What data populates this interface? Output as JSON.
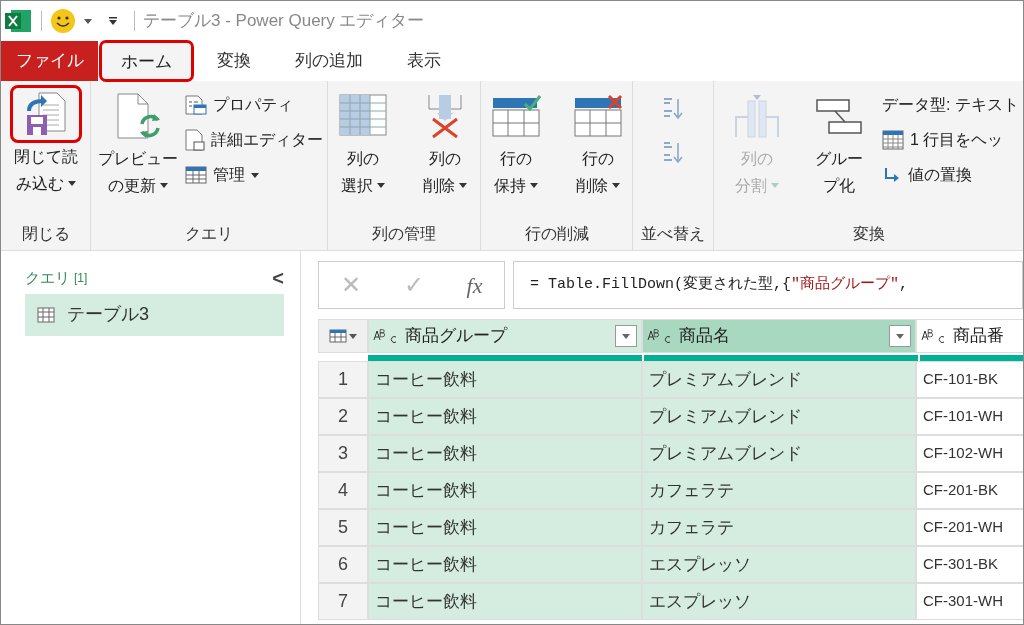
{
  "title_bar": {
    "title": "テーブル3 - Power Query エディター"
  },
  "tabs": [
    {
      "label": "ファイル",
      "kind": "file",
      "selected": false,
      "highlighted": false
    },
    {
      "label": "ホーム",
      "kind": "tab",
      "selected": true,
      "highlighted": true
    },
    {
      "label": "変換",
      "kind": "tab",
      "selected": false,
      "highlighted": false
    },
    {
      "label": "列の追加",
      "kind": "tab",
      "selected": false,
      "highlighted": false
    },
    {
      "label": "表示",
      "kind": "tab",
      "selected": false,
      "highlighted": false
    }
  ],
  "ribbon": {
    "groups": [
      {
        "label": "閉じる",
        "items": [
          {
            "kind": "large",
            "lines": [
              "閉じて読",
              "み込む"
            ],
            "dropdown": true,
            "disabled": false,
            "highlighted": true
          }
        ]
      },
      {
        "label": "クエリ",
        "items": [
          {
            "kind": "large",
            "lines": [
              "プレビュー",
              "の更新"
            ],
            "dropdown": true,
            "disabled": false,
            "highlighted": false
          },
          {
            "kind": "stack",
            "items": [
              {
                "label": "プロパティ",
                "dropdown": false
              },
              {
                "label": "詳細エディター",
                "dropdown": false
              },
              {
                "label": "管理",
                "dropdown": true
              }
            ]
          }
        ]
      },
      {
        "label": "列の管理",
        "items": [
          {
            "kind": "large",
            "lines": [
              "列の",
              "選択"
            ],
            "dropdown": true,
            "disabled": false,
            "highlighted": false
          },
          {
            "kind": "large",
            "lines": [
              "列の",
              "削除"
            ],
            "dropdown": true,
            "disabled": false,
            "highlighted": false
          }
        ]
      },
      {
        "label": "行の削減",
        "items": [
          {
            "kind": "large",
            "lines": [
              "行の",
              "保持"
            ],
            "dropdown": true,
            "disabled": false,
            "highlighted": false
          },
          {
            "kind": "large",
            "lines": [
              "行の",
              "削除"
            ],
            "dropdown": true,
            "disabled": false,
            "highlighted": false
          }
        ]
      },
      {
        "label": "並べ替え",
        "items": [
          {
            "kind": "sort"
          }
        ]
      },
      {
        "label": "変換",
        "items": [
          {
            "kind": "large",
            "lines": [
              "列の",
              "分割"
            ],
            "dropdown": true,
            "disabled": true,
            "highlighted": false
          },
          {
            "kind": "large",
            "lines": [
              "グルー",
              "プ化"
            ],
            "dropdown": false,
            "disabled": false,
            "highlighted": false
          },
          {
            "kind": "stack",
            "items": [
              {
                "label": "データ型: テキスト",
                "dropdown": false
              },
              {
                "label": "1 行目をヘッ",
                "dropdown": false
              },
              {
                "label": "値の置換",
                "dropdown": false
              }
            ]
          }
        ]
      }
    ]
  },
  "queries_pane": {
    "title": "クエリ",
    "count": "[1]",
    "collapse": "<",
    "items": [
      {
        "label": "テーブル3",
        "selected": true
      }
    ]
  },
  "formula_bar": {
    "cancel": "✕",
    "commit": "✓",
    "fx": "fx",
    "segments": [
      {
        "kind": "code",
        "text": "= Table.FillDown(変更された型,{"
      },
      {
        "kind": "string",
        "text": "\"商品グループ\""
      },
      {
        "kind": "code",
        "text": ","
      }
    ]
  },
  "table": {
    "columns": [
      {
        "name": "商品グループ",
        "selected": true,
        "focused": false,
        "dropdown": true
      },
      {
        "name": "商品名",
        "selected": true,
        "focused": true,
        "dropdown": true
      },
      {
        "name": "商品番",
        "selected": false,
        "focused": false,
        "dropdown": false
      }
    ],
    "rows": [
      {
        "number": "1",
        "cells": [
          "コーヒー飲料",
          "プレミアムブレンド",
          "CF-101-BK"
        ]
      },
      {
        "number": "2",
        "cells": [
          "コーヒー飲料",
          "プレミアムブレンド",
          "CF-101-WH"
        ]
      },
      {
        "number": "3",
        "cells": [
          "コーヒー飲料",
          "プレミアムブレンド",
          "CF-102-WH"
        ]
      },
      {
        "number": "4",
        "cells": [
          "コーヒー飲料",
          "カフェラテ",
          "CF-201-BK"
        ]
      },
      {
        "number": "5",
        "cells": [
          "コーヒー飲料",
          "カフェラテ",
          "CF-201-WH"
        ]
      },
      {
        "number": "6",
        "cells": [
          "コーヒー飲料",
          "エスプレッソ",
          "CF-301-BK"
        ]
      },
      {
        "number": "7",
        "cells": [
          "コーヒー飲料",
          "エスプレッソ",
          "CF-301-WH"
        ]
      }
    ]
  }
}
